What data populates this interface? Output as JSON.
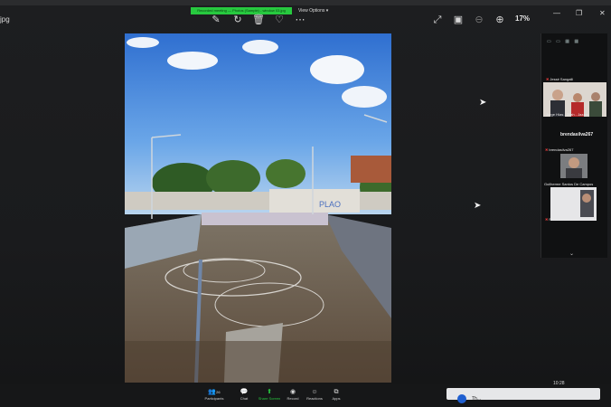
{
  "viewer": {
    "file_name": "jpg",
    "banner_text": "Recorded meeting — Photos (Sample) - window 03.jpg",
    "view_options": "View Options",
    "zoom": "17%"
  },
  "toolbar_icons": [
    "edit-icon",
    "rotate-icon",
    "trash-icon",
    "heart-icon",
    "more-icon",
    "expand-icon",
    "original-size-icon",
    "zoom-out-icon",
    "zoom-in-icon"
  ],
  "participants_panel": {
    "speaker_name": "Jessé Sangalli",
    "speaker_caption": "Jorge Hías - Zilah - Jazzm",
    "heading": "brendasilva267",
    "entries": [
      {
        "name": "brendasilva267"
      },
      {
        "name": "Guilherme Santos De Campos"
      },
      {
        "name": "Paulo carlos laíoto"
      }
    ]
  },
  "controls": {
    "participants_count": "26",
    "participants_label": "Participants",
    "chat_label": "Chat",
    "share_label": "Share Screen",
    "record_label": "Record",
    "reactions_label": "Reactions",
    "apps_label": "Apps"
  },
  "clock": "10:28",
  "notification": "Th..."
}
